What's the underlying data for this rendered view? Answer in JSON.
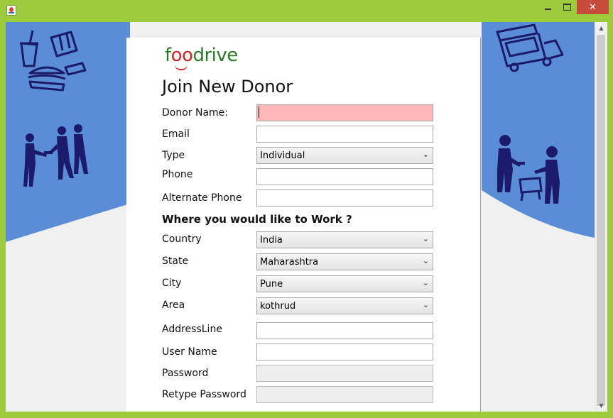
{
  "window": {
    "icon": "java-cup-icon",
    "close_glyph": "✕",
    "theme_color": "#9ccb3b"
  },
  "background": {
    "blue": "#5b8dd6",
    "icon_color": "#1b1a6b",
    "illustrations": [
      "fast-food-icon",
      "people-sharing-food-icon",
      "food-truck-icon",
      "people-serving-food-icon"
    ]
  },
  "logo": {
    "part1": "f",
    "part2": "oo",
    "part3": "drive",
    "green": "#2a7a2a",
    "red": "#c8282a"
  },
  "form": {
    "title": "Join New Donor",
    "labels": {
      "donor_name": "Donor Name:",
      "email": "Email",
      "type": "Type",
      "phone": "Phone",
      "alt_phone": "Alternate Phone",
      "country": "Country",
      "state": "State",
      "city": "City",
      "area": "Area",
      "address": "AddressLine",
      "username": "User Name",
      "password": "Password",
      "retype": "Retype Password"
    },
    "section_heading": "Where you would like to Work ?",
    "values": {
      "donor_name": "",
      "email": "",
      "type": "Individual",
      "phone": "",
      "alt_phone": "",
      "country": "India",
      "state": "Maharashtra",
      "city": "Pune",
      "area": "kothrud",
      "address": "",
      "username": "",
      "password": "",
      "retype": ""
    },
    "invalid_field_color": "#ffb8b8"
  }
}
